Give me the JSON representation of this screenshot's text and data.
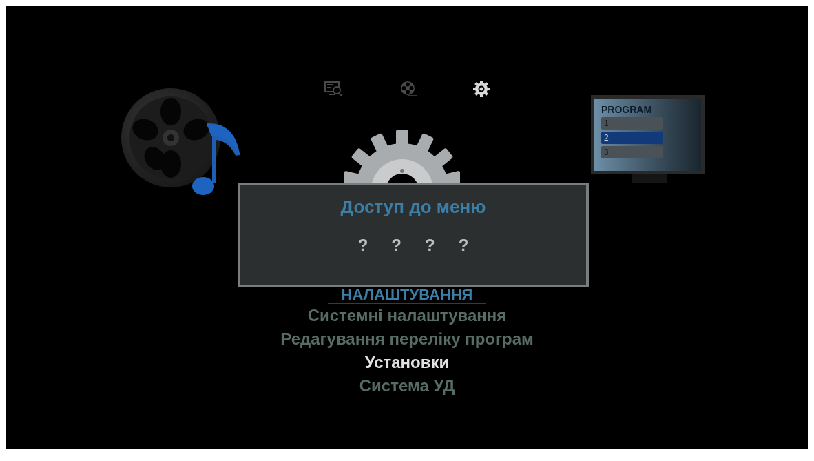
{
  "mode_tabs": [
    {
      "kind": "search",
      "selected": false
    },
    {
      "kind": "media",
      "selected": false
    },
    {
      "kind": "settings",
      "selected": true
    }
  ],
  "preview": {
    "title": "PROGRAM",
    "rows": [
      {
        "label": "1",
        "selected": false
      },
      {
        "label": "2",
        "selected": true
      },
      {
        "label": "3",
        "selected": false
      }
    ]
  },
  "dialog": {
    "title": "Доступ до меню",
    "pin_digits": [
      "?",
      "?",
      "?",
      "?"
    ]
  },
  "menu": {
    "heading": "НАЛАШТУВАННЯ",
    "items": [
      {
        "label": "Системні налаштування",
        "selected": false
      },
      {
        "label": "Редагування переліку програм",
        "selected": false
      },
      {
        "label": "Установки",
        "selected": true
      },
      {
        "label": "Система УД",
        "selected": false
      }
    ]
  }
}
